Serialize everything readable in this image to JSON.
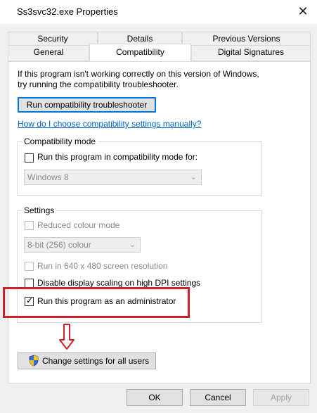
{
  "window": {
    "title": "Ss3svc32.exe Properties",
    "close_glyph": "✕"
  },
  "tabs_top": [
    {
      "label": "Security"
    },
    {
      "label": "Details"
    },
    {
      "label": "Previous Versions"
    }
  ],
  "tabs_bottom": [
    {
      "label": "General"
    },
    {
      "label": "Compatibility"
    },
    {
      "label": "Digital Signatures"
    }
  ],
  "panel": {
    "intro_line1": "If this program isn't working correctly on this version of Windows,",
    "intro_line2": "try running the compatibility troubleshooter.",
    "troubleshooter_button": "Run compatibility troubleshooter",
    "help_link": "How do I choose compatibility settings manually?",
    "compat_group": {
      "legend": "Compatibility mode",
      "checkbox_label": "Run this program in compatibility mode for:",
      "os_select_value": "Windows 8"
    },
    "settings_group": {
      "legend": "Settings",
      "reduced_colour_label": "Reduced colour mode",
      "colour_select_value": "8-bit (256) colour",
      "resolution_label": "Run in 640 x 480 screen resolution",
      "dpi_label": "Disable display scaling on high DPI settings",
      "admin_label": "Run this program as an administrator",
      "admin_checked": true
    },
    "all_users_button": "Change settings for all users"
  },
  "footer": {
    "ok_label": "OK",
    "cancel_label": "Cancel",
    "apply_label": "Apply"
  },
  "colors": {
    "highlight_red": "#d0212b",
    "link_blue": "#0066cc",
    "focus_blue": "#0078d7"
  }
}
